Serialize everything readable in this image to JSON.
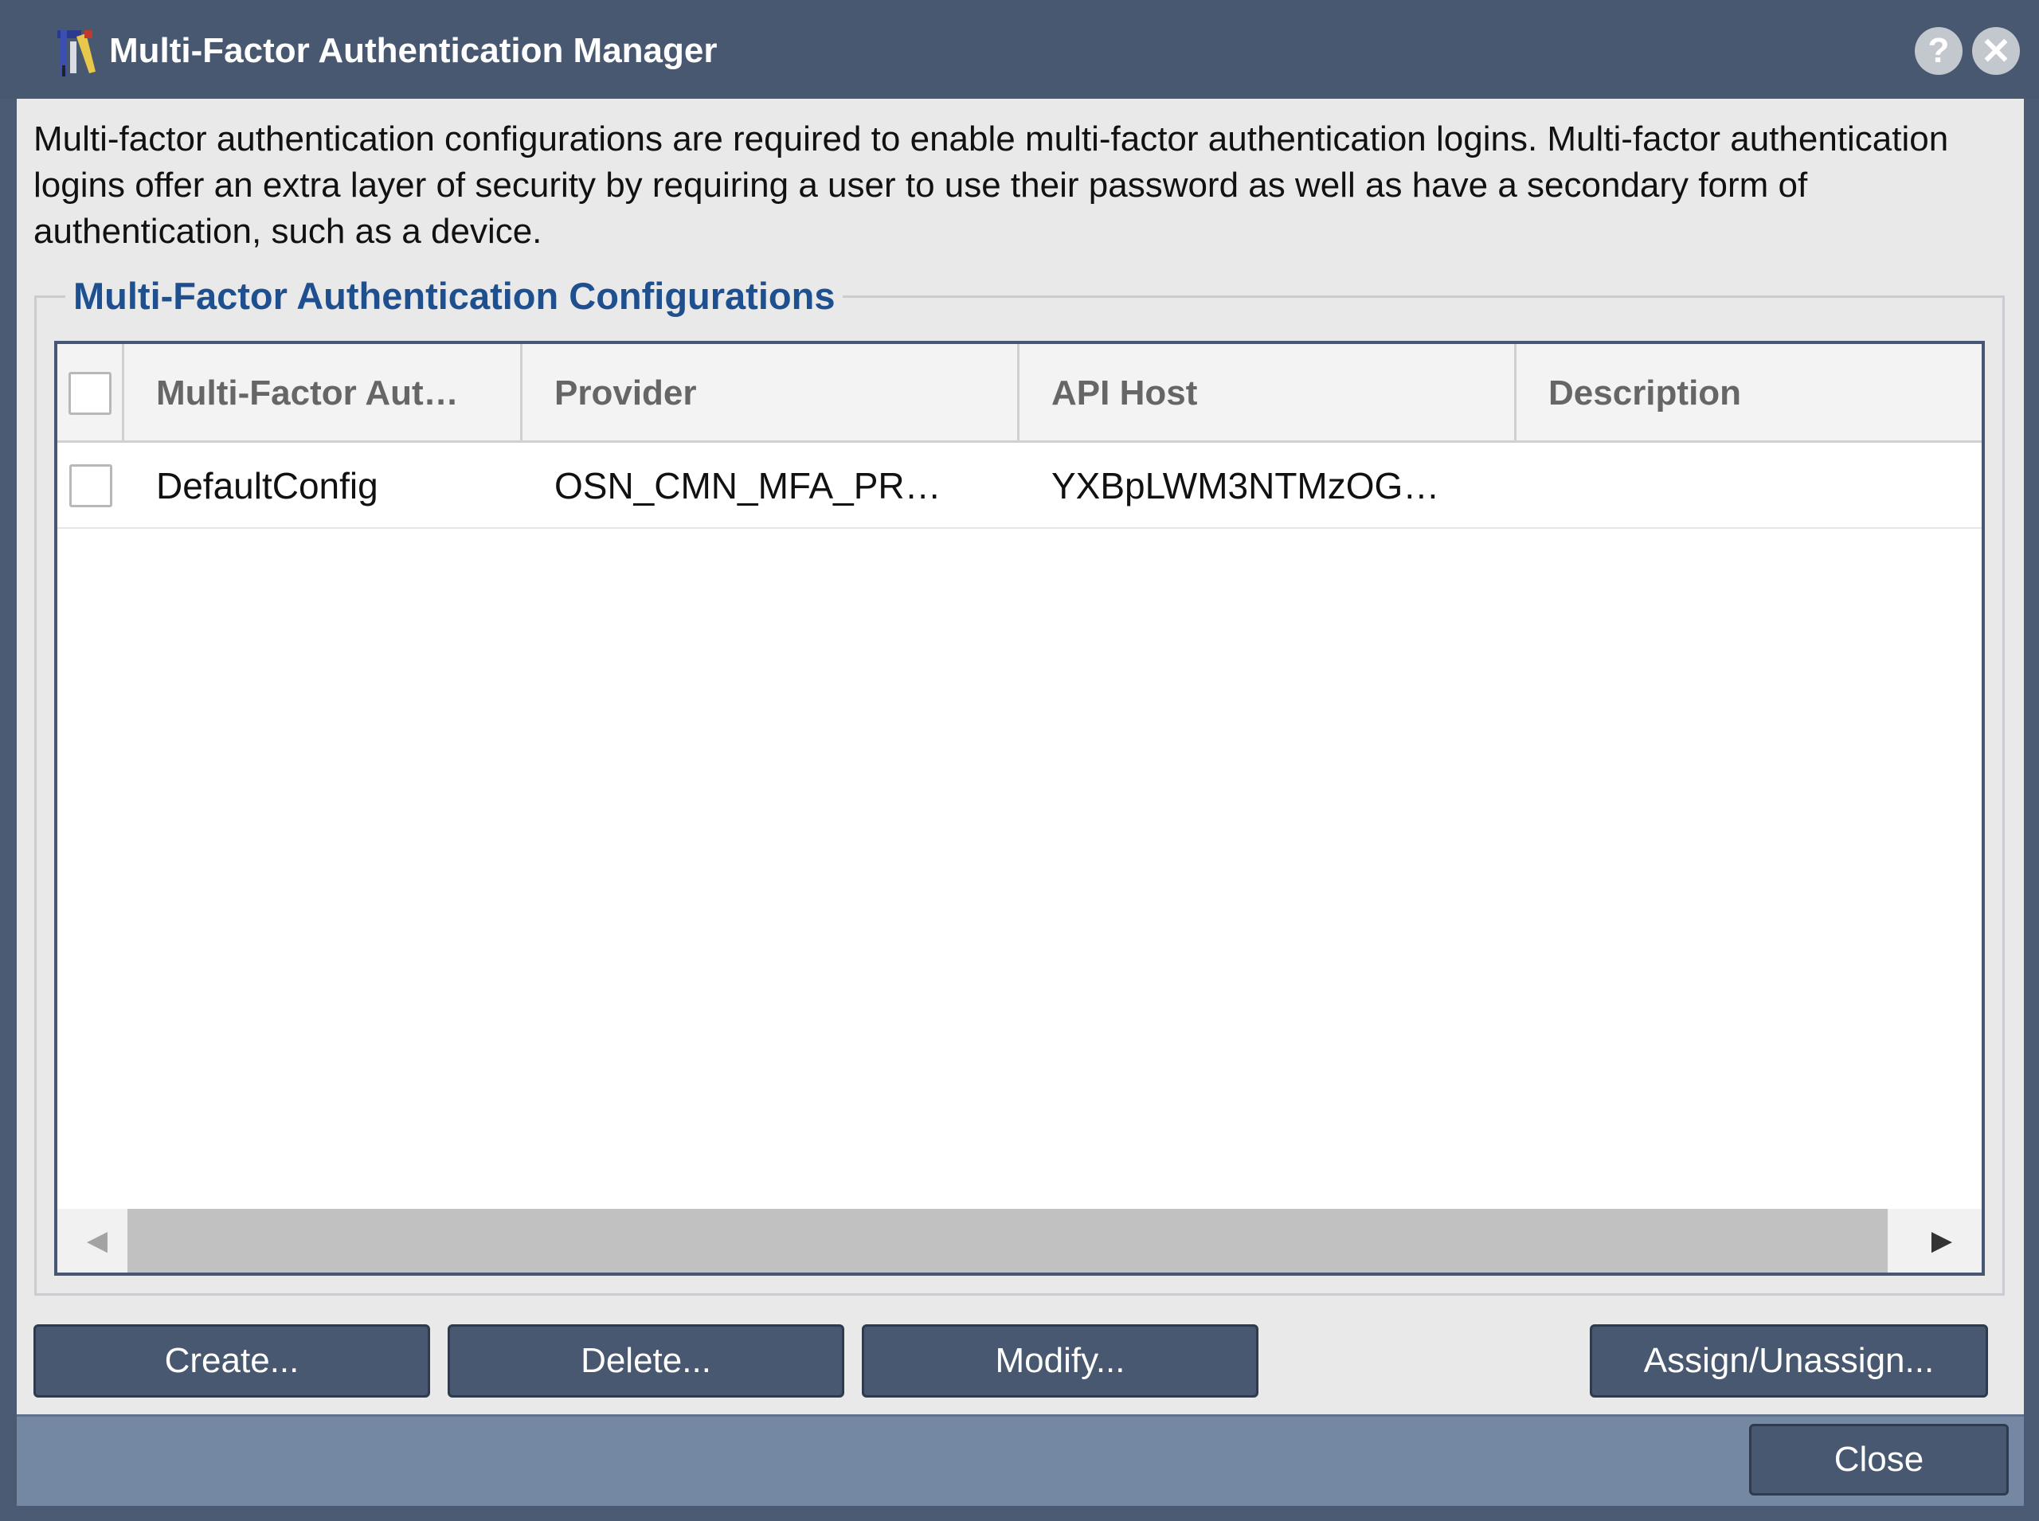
{
  "window": {
    "title": "Multi-Factor Authentication Manager",
    "help_glyph": "?",
    "close_glyph": "✕"
  },
  "description": "Multi-factor authentication configurations are required to enable multi-factor authentication logins. Multi-factor authentication logins offer an extra layer of security by requiring a user to use their password as well as have a secondary form of authentication, such as a device.",
  "section": {
    "legend": "Multi-Factor Authentication Configurations"
  },
  "table": {
    "columns": [
      "Multi-Factor Aut…",
      "Provider",
      "API Host",
      "Description"
    ],
    "rows": [
      {
        "name": "DefaultConfig",
        "provider": "OSN_CMN_MFA_PR…",
        "api_host": "YXBpLWM3NTMzOG…",
        "description": ""
      }
    ]
  },
  "scrollbar": {
    "left_glyph": "◀",
    "right_glyph": "▶"
  },
  "buttons": {
    "create": "Create...",
    "delete": "Delete...",
    "modify": "Modify...",
    "assign": "Assign/Unassign...",
    "close": "Close"
  },
  "colors": {
    "title_bar": "#485870",
    "legend": "#1e4f8e",
    "button": "#485870",
    "footer": "#7588a3"
  }
}
